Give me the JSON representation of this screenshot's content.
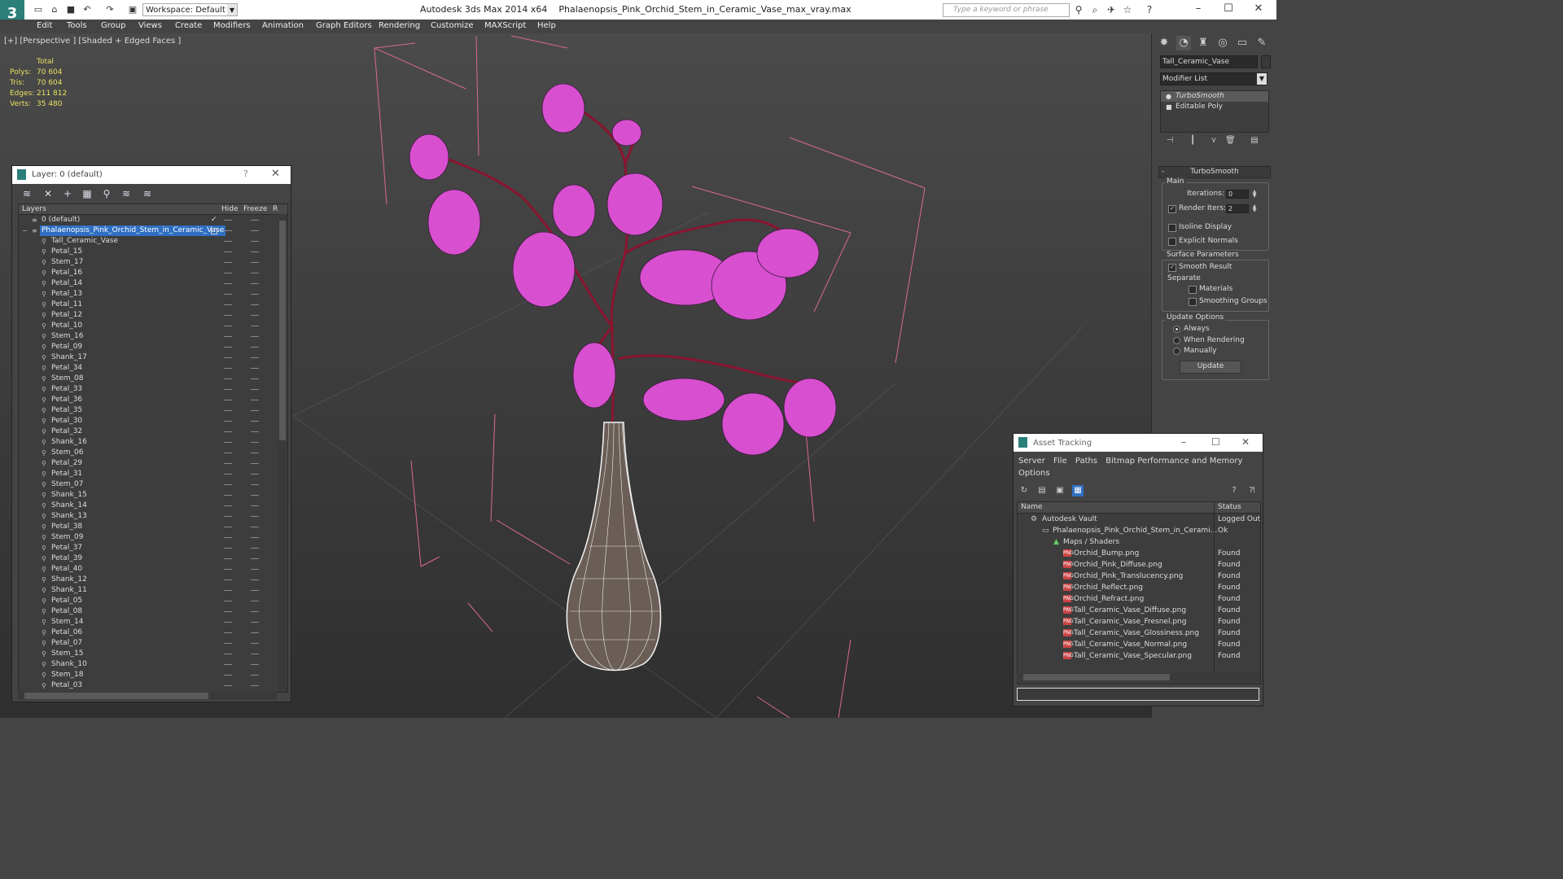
{
  "app": {
    "title": "Autodesk 3ds Max  2014 x64",
    "file": "Phalaenopsis_Pink_Orchid_Stem_in_Ceramic_Vase_max_vray.max",
    "workspace": "Workspace: Default",
    "search_placeholder": "Type a keyword or phrase"
  },
  "menu": [
    "Edit",
    "Tools",
    "Group",
    "Views",
    "Create",
    "Modifiers",
    "Animation",
    "Graph Editors",
    "Rendering",
    "Customize",
    "MAXScript",
    "Help"
  ],
  "viewport": {
    "label": "[+] [Perspective ] [Shaded + Edged Faces ]",
    "stats": {
      "header": "Total",
      "rows": [
        {
          "k": "Polys:",
          "v": "70 604"
        },
        {
          "k": "Tris:",
          "v": "70 604"
        },
        {
          "k": "Edges:",
          "v": "211 812"
        },
        {
          "k": "Verts:",
          "v": "35 480"
        }
      ]
    },
    "wire_color": "#e05a8a",
    "petal_color": "#d84fd0"
  },
  "command_panel": {
    "object_name": "Tall_Ceramic_Vase",
    "modifier_list": "Modifier List",
    "stack": [
      "TurboSmooth",
      "Editable Poly"
    ],
    "rollout": "TurboSmooth",
    "main_label": "Main",
    "iterations_label": "Iterations:",
    "iterations": "0",
    "render_iters_label": "Render Iters:",
    "render_iters": "2",
    "isoline": "Isoline Display",
    "explicit_normals": "Explicit Normals",
    "surface_params": "Surface Parameters",
    "smooth_result": "Smooth Result",
    "separate": "Separate",
    "materials": "Materials",
    "smoothing_groups": "Smoothing Groups",
    "update_options": "Update Options",
    "always": "Always",
    "when_rendering": "When Rendering",
    "manually": "Manually",
    "update_btn": "Update"
  },
  "layer_window": {
    "title": "Layer: 0 (default)",
    "help": "?",
    "columns": {
      "layers": "Layers",
      "hide": "Hide",
      "freeze": "Freeze",
      "r": "R"
    },
    "default_layer": "0 (default)",
    "active_layer": "Phalaenopsis_Pink_Orchid_Stem_in_Ceramic_Vase",
    "objects": [
      "Tall_Ceramic_Vase",
      "Petal_15",
      "Stem_17",
      "Petal_16",
      "Petal_14",
      "Petal_13",
      "Petal_11",
      "Petal_12",
      "Petal_10",
      "Stem_16",
      "Petal_09",
      "Shank_17",
      "Petal_34",
      "Stem_08",
      "Petal_33",
      "Petal_36",
      "Petal_35",
      "Petal_30",
      "Petal_32",
      "Shank_16",
      "Stem_06",
      "Petal_29",
      "Petal_31",
      "Stem_07",
      "Shank_15",
      "Shank_14",
      "Shank_13",
      "Petal_38",
      "Stem_09",
      "Petal_37",
      "Petal_39",
      "Petal_40",
      "Shank_12",
      "Shank_11",
      "Petal_05",
      "Petal_08",
      "Stem_14",
      "Petal_06",
      "Petal_07",
      "Stem_15",
      "Shank_10",
      "Stem_18",
      "Petal_03"
    ]
  },
  "asset_window": {
    "title": "Asset Tracking",
    "menu": [
      "Server",
      "File",
      "Paths",
      "Bitmap Performance and Memory",
      "Options"
    ],
    "columns": {
      "name": "Name",
      "status": "Status"
    },
    "vault": {
      "name": "Autodesk Vault",
      "status": "Logged Out"
    },
    "file": {
      "name": "Phalaenopsis_Pink_Orchid_Stem_in_Cerami...",
      "status": "Ok"
    },
    "maps": "Maps / Shaders",
    "assets": [
      {
        "name": "Orchid_Bump.png",
        "status": "Found"
      },
      {
        "name": "Orchid_Pink_Diffuse.png",
        "status": "Found"
      },
      {
        "name": "Orchid_Pink_Translucency.png",
        "status": "Found"
      },
      {
        "name": "Orchid_Reflect.png",
        "status": "Found"
      },
      {
        "name": "Orchid_Refract.png",
        "status": "Found"
      },
      {
        "name": "Tall_Ceramic_Vase_Diffuse.png",
        "status": "Found"
      },
      {
        "name": "Tall_Ceramic_Vase_Fresnel.png",
        "status": "Found"
      },
      {
        "name": "Tall_Ceramic_Vase_Glossiness.png",
        "status": "Found"
      },
      {
        "name": "Tall_Ceramic_Vase_Normal.png",
        "status": "Found"
      },
      {
        "name": "Tall_Ceramic_Vase_Specular.png",
        "status": "Found"
      }
    ]
  }
}
